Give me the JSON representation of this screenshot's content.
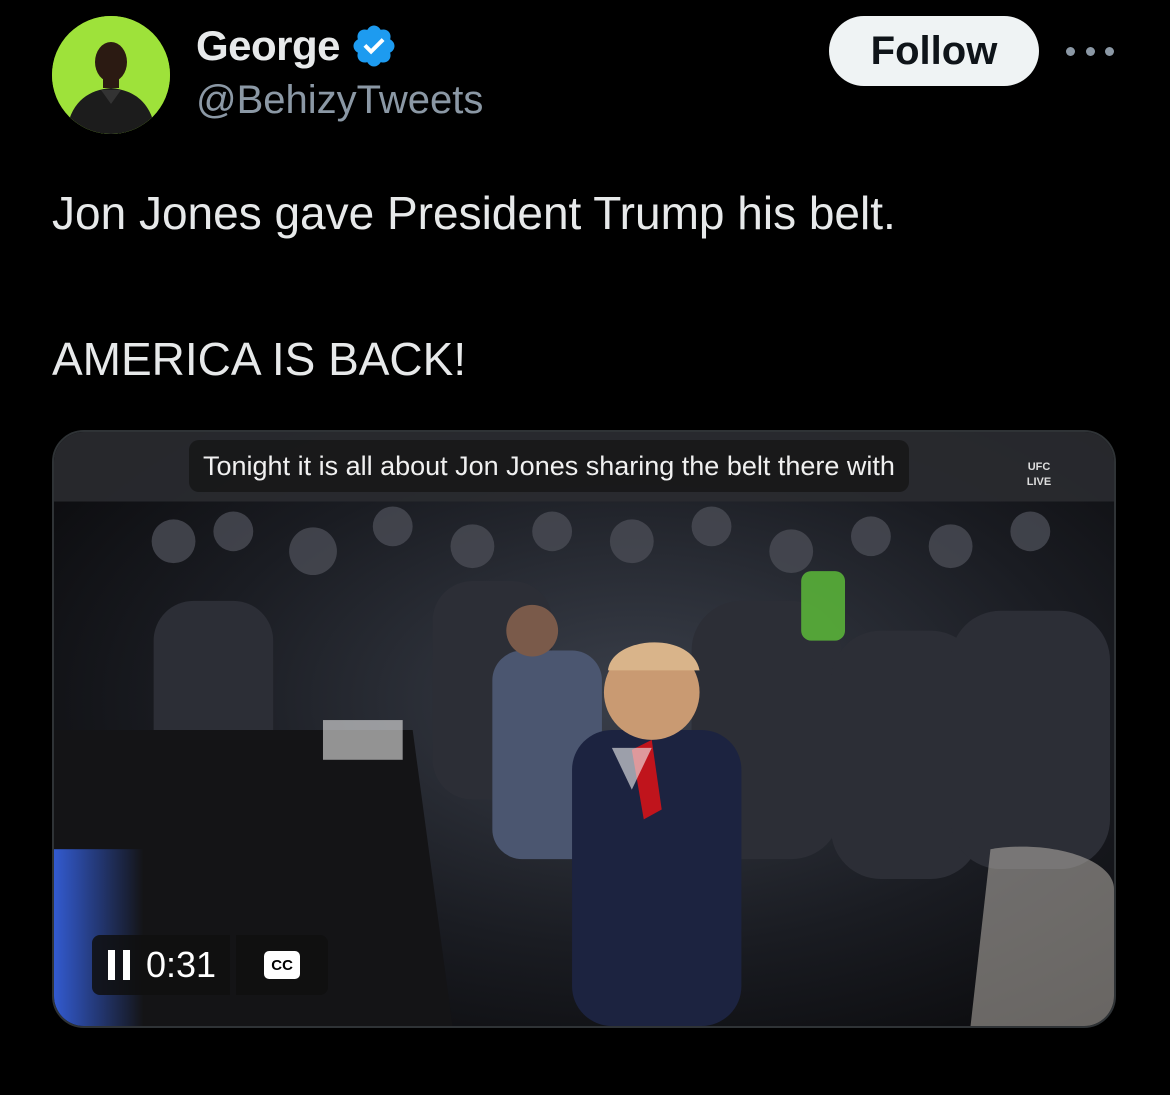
{
  "author": {
    "display_name": "George",
    "handle": "@BehizyTweets",
    "verified": true,
    "avatar_icon": "profile-avatar",
    "verified_icon": "verified-badge-icon",
    "verified_color": "#1d9bf0"
  },
  "header": {
    "follow_label": "Follow",
    "more_icon": "more-options-icon"
  },
  "tweet": {
    "line1": "Jon Jones gave President Trump his belt.",
    "line2": "AMERICA IS BACK!"
  },
  "video": {
    "caption": "Tonight it is all about Jon Jones sharing the belt there with",
    "channel_logo_top": "UFC",
    "channel_logo_bottom": "LIVE",
    "elapsed_time": "0:31",
    "playback_state": "playing",
    "pause_icon": "pause-icon",
    "cc_label": "CC",
    "cc_icon": "closed-captions-icon"
  },
  "colors": {
    "background": "#000000",
    "text_primary": "#e7e9ea",
    "text_secondary": "#8b98a5",
    "follow_bg": "#eff3f4"
  }
}
